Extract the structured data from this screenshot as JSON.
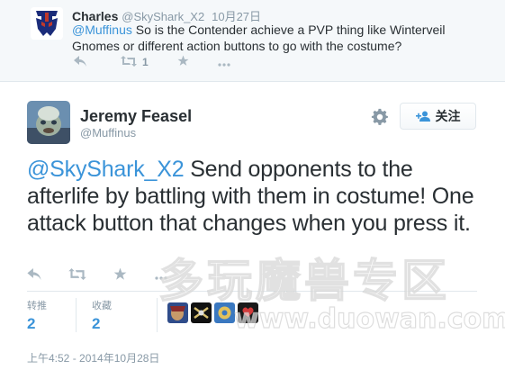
{
  "reply": {
    "name": "Charles",
    "handle": "@SkyShark_X2",
    "time": "10月27日",
    "mention": "@Muffinus",
    "text": " So is the Contender achieve a PVP thing like Winterveil Gnomes or different action buttons to go with the costume?",
    "retweet_count": "1",
    "icons": [
      "reply-icon",
      "retweet-icon",
      "favorite-icon",
      "more-icon"
    ]
  },
  "tweet": {
    "name": "Jeremy Feasel",
    "handle": "@Muffinus",
    "follow_label": "关注",
    "mention": "@SkyShark_X2",
    "text": " Send opponents to the afterlife by battling with them in costume! One attack button that changes when you press it.",
    "stats": {
      "retweets_label": "转推",
      "retweets": "2",
      "favorites_label": "收藏",
      "favorites": "2"
    },
    "timestamp": "上午4:52 - 2014年10月28日"
  },
  "watermark": {
    "cn": "多玩魔兽专区",
    "url": "www.duowan.com"
  },
  "colors": {
    "link": "#3b94d9",
    "muted": "#8899a6",
    "icon": "#aab8c2"
  }
}
